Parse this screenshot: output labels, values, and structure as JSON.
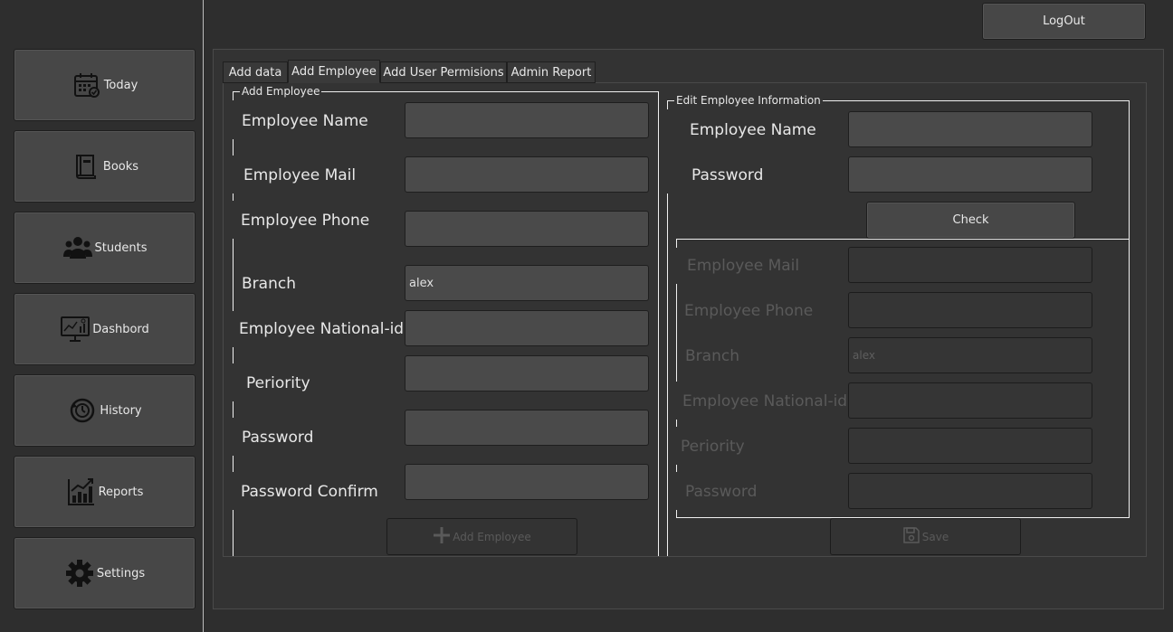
{
  "sidebar": {
    "items": [
      {
        "label": "Today",
        "icon": "calendar-icon"
      },
      {
        "label": "Books",
        "icon": "book-icon"
      },
      {
        "label": "Students",
        "icon": "users-icon"
      },
      {
        "label": "Dashbord",
        "icon": "dashboard-icon"
      },
      {
        "label": "History",
        "icon": "history-icon"
      },
      {
        "label": "Reports",
        "icon": "reports-icon"
      },
      {
        "label": "Settings",
        "icon": "gear-icon"
      }
    ]
  },
  "header": {
    "logout_label": "LogOut"
  },
  "tabs": [
    "Add data",
    "Add Employee",
    "Add User Permisions",
    "Admin Report"
  ],
  "active_tab": "Add Employee",
  "add_employee": {
    "group_title": "Add Employee",
    "fields": [
      {
        "label": "Employee Name",
        "value": ""
      },
      {
        "label": "Employee Mail",
        "value": ""
      },
      {
        "label": "Employee Phone",
        "value": ""
      },
      {
        "label": "Branch",
        "value": "alex"
      },
      {
        "label": "Employee National-id",
        "value": ""
      },
      {
        "label": "Periority",
        "value": ""
      },
      {
        "label": "Password",
        "value": ""
      },
      {
        "label": "Password Confirm",
        "value": ""
      }
    ],
    "submit_label": "Add Employee"
  },
  "edit_employee": {
    "group_title": "Edit Employee Information",
    "name_label": "Employee Name",
    "password_label": "Password",
    "check_label": "Check",
    "fields": [
      {
        "label": "Employee Mail",
        "value": ""
      },
      {
        "label": "Employee Phone",
        "value": ""
      },
      {
        "label": "Branch",
        "value": "alex"
      },
      {
        "label": "Employee National-id",
        "value": ""
      },
      {
        "label": "Periority",
        "value": ""
      },
      {
        "label": "Password",
        "value": ""
      }
    ],
    "save_label": "Save"
  },
  "colors": {
    "background": "#2e2e2e",
    "button": "#474747",
    "input": "#4a4a4a",
    "disabled_text": "#5a5a5a",
    "group_border": "#f0f0f0"
  }
}
